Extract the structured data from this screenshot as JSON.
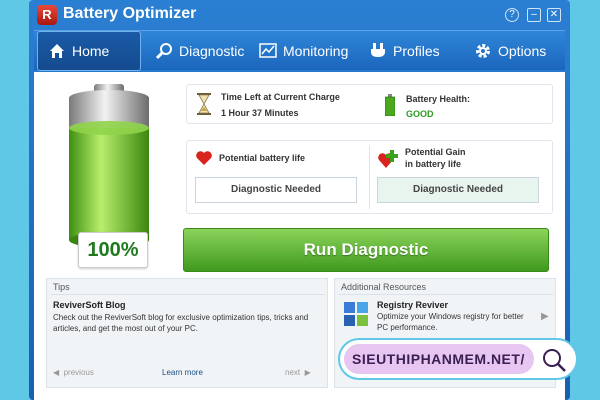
{
  "window": {
    "title": "Battery Optimizer",
    "logo_text": "R",
    "help_glyph": "?",
    "minimize_glyph": "–",
    "close_glyph": "✕"
  },
  "nav": {
    "items": [
      {
        "label": "Home",
        "icon": "home-icon"
      },
      {
        "label": "Diagnostic",
        "icon": "magnifier-icon"
      },
      {
        "label": "Monitoring",
        "icon": "monitor-chart-icon"
      },
      {
        "label": "Profiles",
        "icon": "plug-icon"
      },
      {
        "label": "Options",
        "icon": "gear-icon"
      }
    ],
    "active": "Home"
  },
  "battery": {
    "percent_text": "100%",
    "level_fraction": 1.0
  },
  "time_left": {
    "label": "Time Left at Current Charge",
    "value": "1 Hour 37 Minutes"
  },
  "health": {
    "label": "Battery Health:",
    "value": "GOOD"
  },
  "potential_life": {
    "label": "Potential battery life",
    "status": "Diagnostic Needed"
  },
  "potential_gain": {
    "label_line1": "Potential Gain",
    "label_line2": "in battery life",
    "status": "Diagnostic Needed"
  },
  "run_button": {
    "label": "Run Diagnostic"
  },
  "tips": {
    "section_title": "Tips",
    "heading": "ReviverSoft Blog",
    "body": "Check out the ReviverSoft blog for exclusive optimization tips, tricks and articles, and get the most out of your PC.",
    "previous": "previous",
    "learn_more": "Learn more",
    "next": "next"
  },
  "resources": {
    "section_title": "Additional Resources",
    "heading": "Registry Reviver",
    "body": "Optimize your Windows registry for better PC performance."
  },
  "watermark": {
    "text": "SIEUTHIPHANMEM.NET/"
  },
  "colors": {
    "accent_blue": "#1b66bd",
    "run_green": "#3f9a1e",
    "good_green": "#2e9a22",
    "page_bg": "#5fc8e6"
  }
}
